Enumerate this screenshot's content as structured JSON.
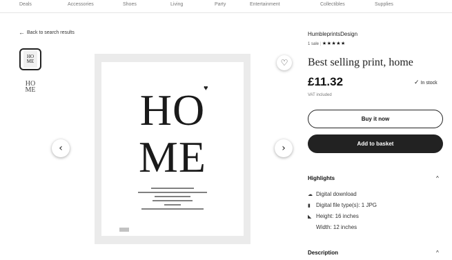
{
  "nav": [
    "Deals",
    "Accessories",
    "Shoes",
    "Living",
    "Party",
    "Entertainment",
    "Collectibles",
    "Supplies"
  ],
  "back_link": "Back to search results",
  "thumbnails": [
    {
      "top": "HO",
      "bottom": "ME"
    },
    {
      "top": "HO",
      "bottom": "ME"
    }
  ],
  "poster": {
    "top": "HO",
    "bottom": "ME"
  },
  "product": {
    "shop_name": "HumbleprintsDesign",
    "sales": "1 sale",
    "stars": "★★★★★",
    "title": "Best selling print, home",
    "price": "£11.32",
    "stock": "In stock",
    "vat": "VAT included"
  },
  "buttons": {
    "buy": "Buy it now",
    "basket": "Add to basket"
  },
  "highlights": {
    "title": "Highlights",
    "items": [
      "Digital download",
      "Digital file type(s): 1 JPG",
      "Height: 16 inches",
      "Width: 12 inches"
    ]
  },
  "description": {
    "title": "Description"
  }
}
